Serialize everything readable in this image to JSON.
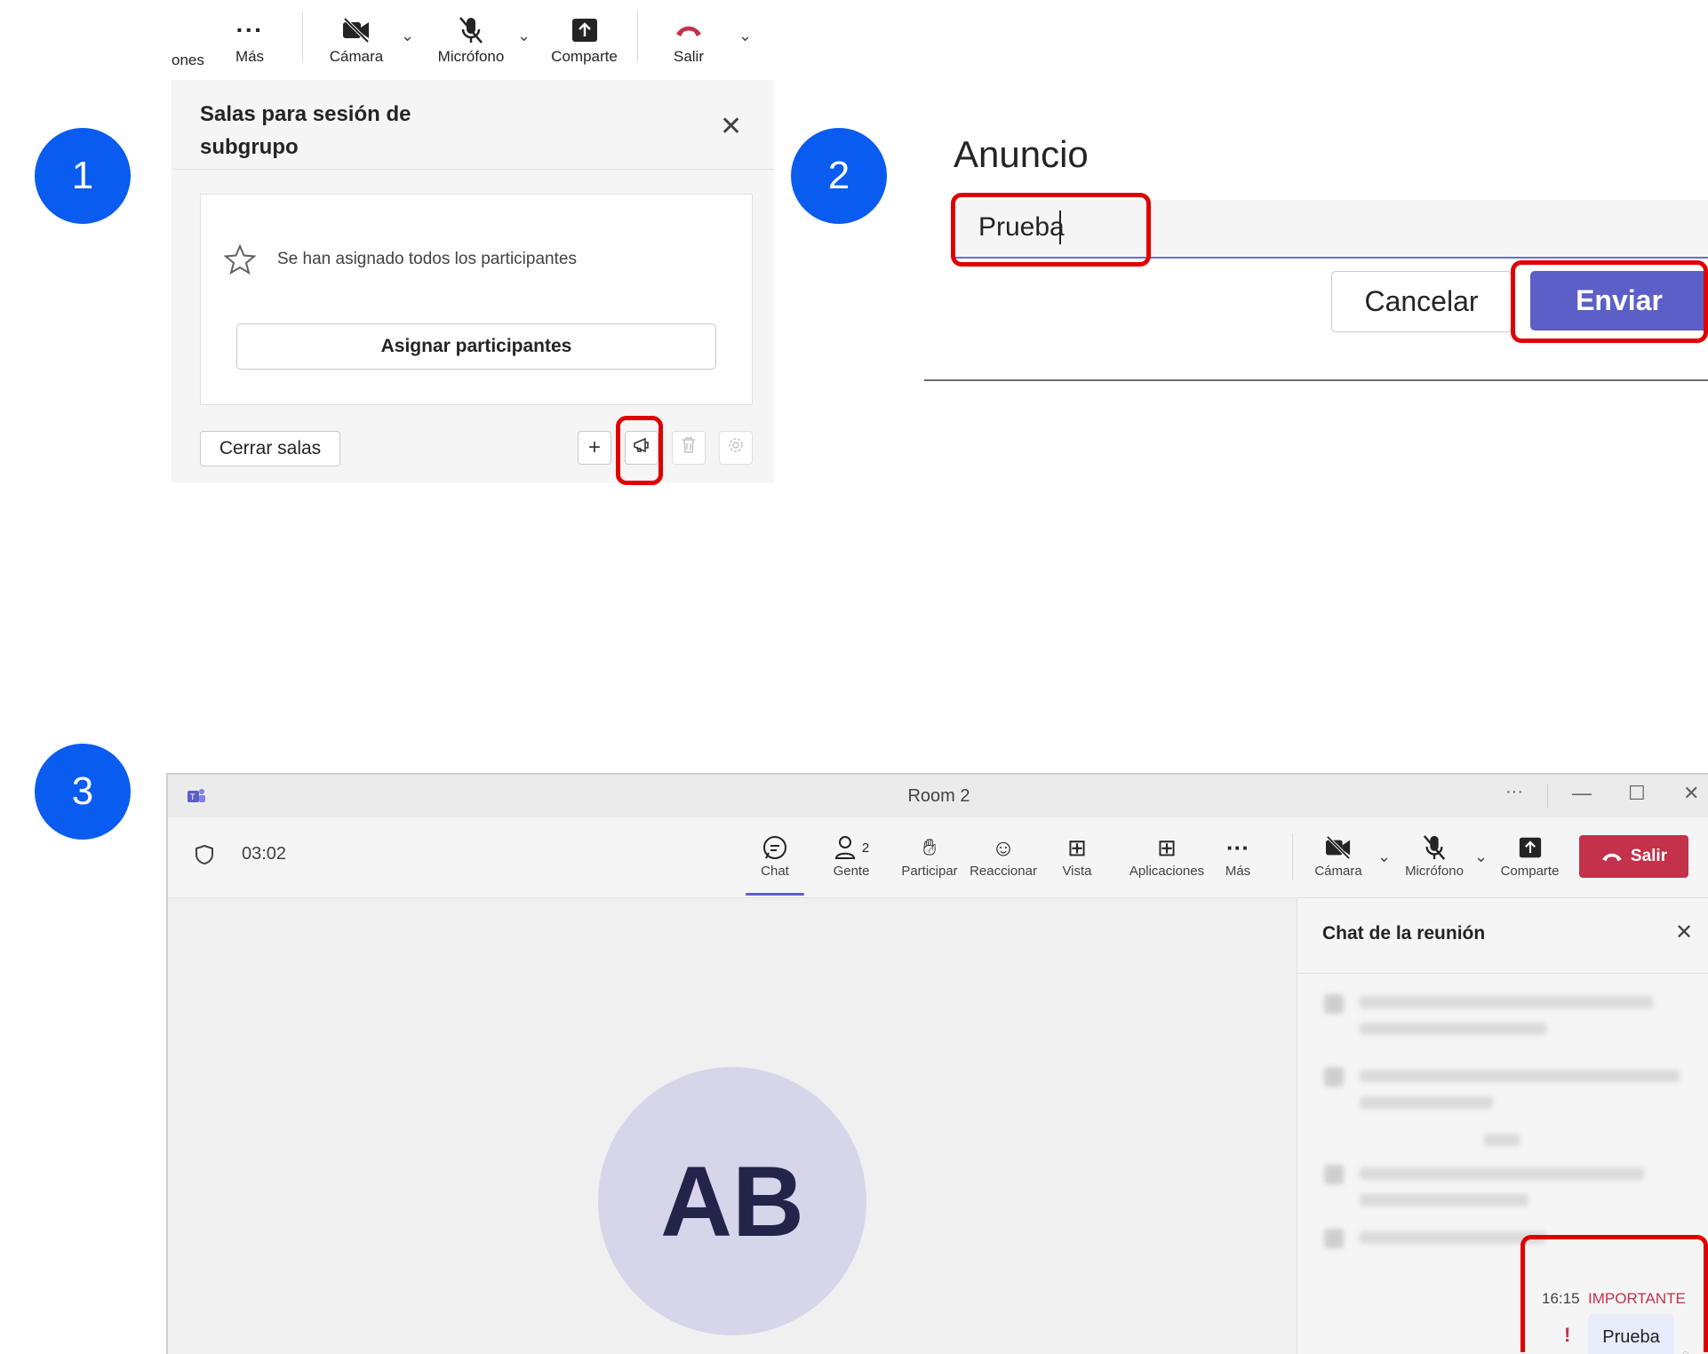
{
  "steps": {
    "one": "1",
    "two": "2",
    "three": "3"
  },
  "panel1": {
    "toolbar": {
      "cut_label": "ones",
      "more_label": "Más",
      "camera_label": "Cámara",
      "mic_label": "Micrófono",
      "share_label": "Comparte",
      "leave_label": "Salir"
    },
    "title_line1": "Salas para sesión de",
    "title_line2": "subgrupo",
    "status_text": "Se han asignado todos los participantes",
    "assign_button": "Asignar participantes",
    "close_rooms_button": "Cerrar salas",
    "add_symbol": "+",
    "icons": [
      "more-icon",
      "camera-off-icon",
      "mic-off-icon",
      "share-icon",
      "hang-up-icon",
      "close-icon",
      "star-icon",
      "add-icon",
      "announcement-icon",
      "trash-icon",
      "settings-icon"
    ]
  },
  "panel2": {
    "title": "Anuncio",
    "input_value": "Prueba",
    "cancel_button": "Cancelar",
    "send_button": "Enviar",
    "accent": "#5b5fc7"
  },
  "panel3": {
    "window_title": "Room 2",
    "timer": "03:02",
    "toolbar": {
      "chat": "Chat",
      "people_count": "2",
      "people": "Gente",
      "raise": "Participar",
      "react": "Reaccionar",
      "view": "Vista",
      "apps": "Aplicaciones",
      "more": "Más",
      "camera": "Cámara",
      "mic": "Micrófono",
      "share": "Comparte",
      "leave": "Salir"
    },
    "avatar_initials": "AB",
    "chat_title": "Chat de la reunión",
    "message": {
      "time": "16:15",
      "importance": "IMPORTANTE",
      "text": "Prueba",
      "mark": "!"
    },
    "colors": {
      "leave": "#c4314b",
      "importance": "#c4314b",
      "avatar_bg": "#d7d5ea"
    }
  }
}
